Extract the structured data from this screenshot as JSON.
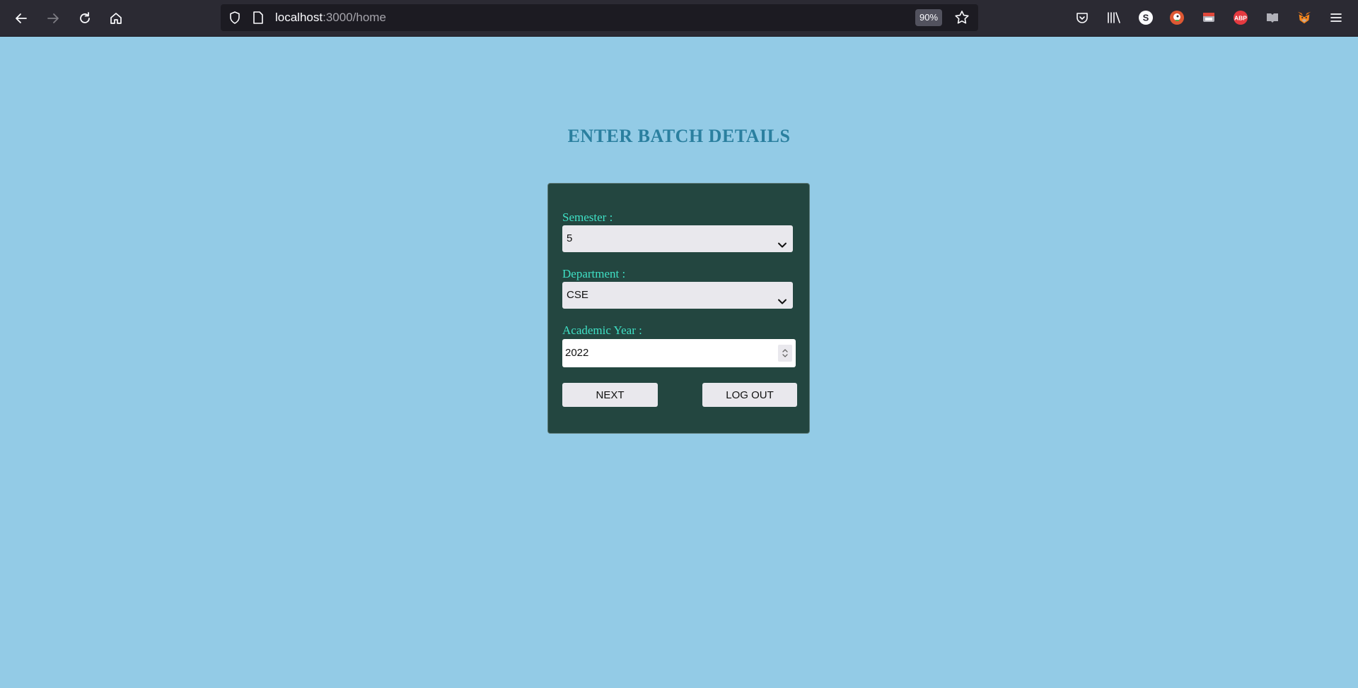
{
  "browser": {
    "url_host": "localhost",
    "url_path": ":3000/home",
    "zoom": "90%",
    "icons": [
      "back-icon",
      "forward-icon",
      "reload-icon",
      "home-icon",
      "shield-icon",
      "page-icon",
      "star-icon",
      "pocket-icon",
      "library-icon",
      "s-extension-icon",
      "duckduckgo-icon",
      "screenshot-icon",
      "adblock-plus-icon",
      "reader-view-icon",
      "metamask-icon",
      "menu-icon"
    ],
    "abp_label": "ABP",
    "s_label": "S"
  },
  "page": {
    "title": "ENTER BATCH DETAILS",
    "form": {
      "semester_label": "Semester :",
      "semester_value": "5",
      "department_label": "Department :",
      "department_value": "CSE",
      "year_label": "Academic Year :",
      "year_value": "2022",
      "next_label": "NEXT",
      "logout_label": "LOG OUT"
    }
  },
  "colors": {
    "page_bg": "#93cbe6",
    "title": "#2a7f9f",
    "card_bg": "#234640",
    "label": "#3fe0c5"
  }
}
